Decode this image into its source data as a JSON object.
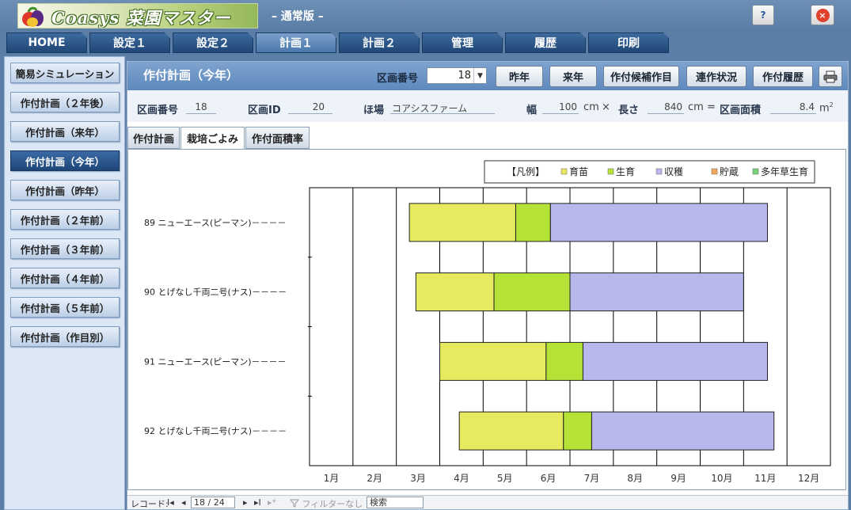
{
  "app": {
    "logo_text": "Coasys 菜園マスター",
    "edition": "– 通常版 –",
    "help_label": "?",
    "close_label": "×"
  },
  "main_tabs": [
    "HOME",
    "設定１",
    "設定２",
    "計画１",
    "計画２",
    "管理",
    "履歴",
    "印刷"
  ],
  "active_main_tab": "計画１",
  "left_menu": [
    "簡易シミュレーション",
    "作付計画（２年後）",
    "作付計画（来年）",
    "作付計画（今年）",
    "作付計画（昨年）",
    "作付計画（２年前）",
    "作付計画（３年前）",
    "作付計画（４年前）",
    "作付計画（５年前）",
    "作付計画（作目別）"
  ],
  "active_left_item": "作付計画（今年）",
  "panel": {
    "title": "作付計画（今年）",
    "plot_number_label": "区画番号",
    "plot_number_value": "18",
    "buttons": [
      "昨年",
      "来年",
      "作付候補作目",
      "連作状況",
      "作付履歴"
    ],
    "print_icon": "printer-icon"
  },
  "info": {
    "plot_no_label": "区画番号",
    "plot_no": "18",
    "plot_id_label": "区画ID",
    "plot_id": "20",
    "field_label": "ほ場",
    "field": "コアシスファーム",
    "width_label": "幅",
    "width": "100",
    "unit_cm": "cm",
    "times": "×",
    "length_label": "長さ",
    "length": "840",
    "equals": "=",
    "area_label": "区画面積",
    "area": "8.4",
    "area_unit": "m",
    "area_unit_sup": "2"
  },
  "sub_tabs": [
    "作付計画",
    "栽培ごよみ",
    "作付面積率"
  ],
  "active_sub_tab": "栽培ごよみ",
  "chart_data": {
    "type": "bar",
    "legend_title": "【凡例】",
    "legend_placement": "top-right",
    "legend": [
      {
        "name": "育苗",
        "color": "#e6ea5e"
      },
      {
        "name": "生育",
        "color": "#b5e236"
      },
      {
        "name": "収穫",
        "color": "#b8b8ec"
      },
      {
        "name": "貯蔵",
        "color": "#f0a858"
      },
      {
        "name": "多年草生育",
        "color": "#7ad07a"
      }
    ],
    "x_tick_labels": [
      "1月",
      "2月",
      "3月",
      "4月",
      "5月",
      "6月",
      "7月",
      "8月",
      "9月",
      "10月",
      "11月",
      "12月"
    ],
    "xlim": [
      0,
      12
    ],
    "grid": true,
    "rows": [
      {
        "label": "89 ニューエース(ピーマン)－－－－",
        "segments": [
          {
            "stage": "育苗",
            "start": 2.3,
            "end": 4.75
          },
          {
            "stage": "生育",
            "start": 4.75,
            "end": 5.55
          },
          {
            "stage": "収穫",
            "start": 5.55,
            "end": 10.55
          }
        ]
      },
      {
        "label": "90 とげなし千両二号(ナス)－－－－",
        "segments": [
          {
            "stage": "育苗",
            "start": 2.45,
            "end": 4.25
          },
          {
            "stage": "生育",
            "start": 4.25,
            "end": 6.0
          },
          {
            "stage": "収穫",
            "start": 6.0,
            "end": 10.0
          }
        ]
      },
      {
        "label": "91 ニューエース(ピーマン)－－－－",
        "segments": [
          {
            "stage": "育苗",
            "start": 3.0,
            "end": 5.45
          },
          {
            "stage": "生育",
            "start": 5.45,
            "end": 6.3
          },
          {
            "stage": "収穫",
            "start": 6.3,
            "end": 10.55
          }
        ]
      },
      {
        "label": "92 とげなし千両二号(ナス)－－－－",
        "segments": [
          {
            "stage": "育苗",
            "start": 3.45,
            "end": 5.85
          },
          {
            "stage": "生育",
            "start": 5.85,
            "end": 6.5
          },
          {
            "stage": "収穫",
            "start": 6.5,
            "end": 10.7
          }
        ]
      }
    ]
  },
  "record_nav": {
    "label": "レコード:",
    "first": "I◂",
    "prev": "◂",
    "position": "18 / 24",
    "next": "▸",
    "last": "▸I",
    "new": "▸*",
    "filter": "フィルターなし",
    "search": "検索"
  }
}
